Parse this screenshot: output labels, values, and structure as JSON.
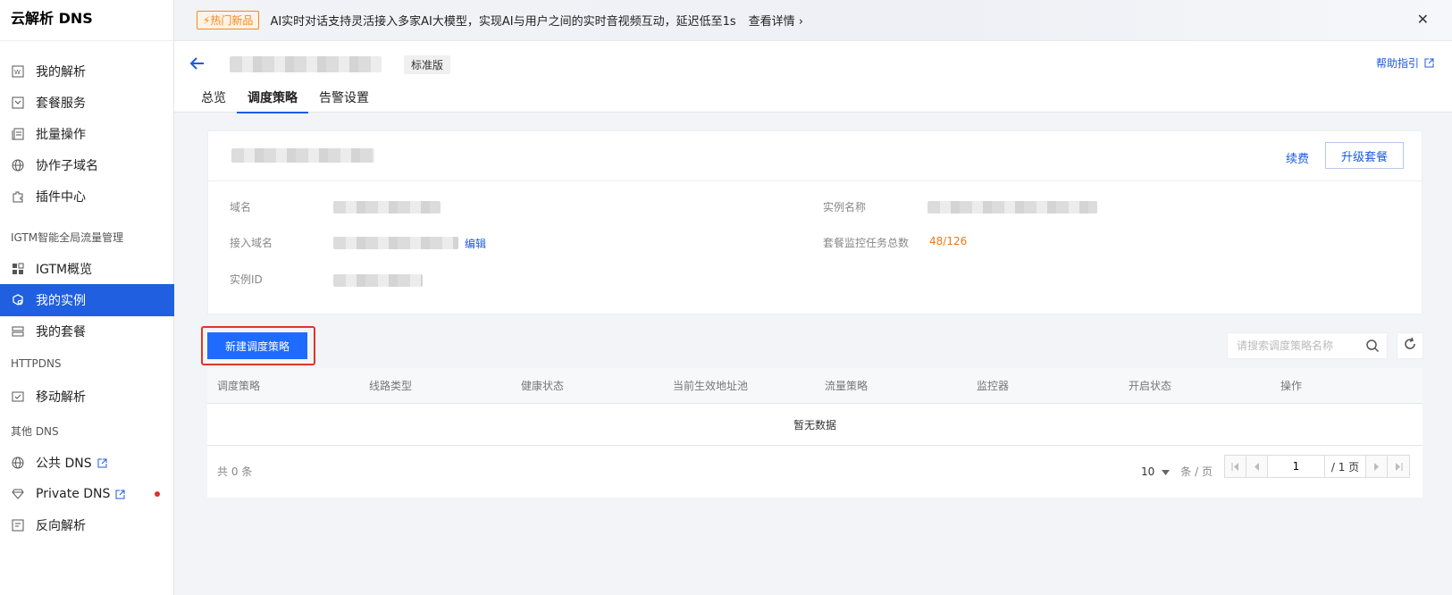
{
  "sidebar": {
    "title": "云解析 DNS",
    "items": [
      {
        "label": "我的解析",
        "icon": "my-dns-icon"
      },
      {
        "label": "套餐服务",
        "icon": "package-icon"
      },
      {
        "label": "批量操作",
        "icon": "batch-icon"
      },
      {
        "label": "协作子域名",
        "icon": "globe-icon"
      },
      {
        "label": "插件中心",
        "icon": "plugin-icon"
      },
      {
        "label": "IGTM概览",
        "icon": "grid-icon"
      },
      {
        "label": "我的实例",
        "icon": "instance-icon"
      },
      {
        "label": "我的套餐",
        "icon": "list-icon"
      },
      {
        "label": "移动解析",
        "icon": "mobile-dns-icon"
      },
      {
        "label": "公共 DNS",
        "icon": "globe-icon"
      },
      {
        "label": "Private DNS",
        "icon": "diamond-icon"
      },
      {
        "label": "反向解析",
        "icon": "reverse-icon"
      }
    ],
    "groups": [
      "IGTM智能全局流量管理",
      "HTTPDNS",
      "其他 DNS"
    ]
  },
  "banner": {
    "tag": "⚡热门新品",
    "text": "AI实时对话支持灵活接入多家AI大模型，实现AI与用户之间的实时音视频互动，延迟低至1s",
    "link": "查看详情 ›",
    "close": "✕"
  },
  "header": {
    "badge": "标准版",
    "help": "帮助指引",
    "tabs": [
      "总览",
      "调度策略",
      "告警设置"
    ],
    "active_tab": "调度策略"
  },
  "card": {
    "renew": "续费",
    "upgrade": "升级套餐",
    "labels": {
      "domain": "域名",
      "access_domain": "接入域名",
      "instance_id": "实例ID",
      "instance_name": "实例名称",
      "monitor_total": "套餐监控任务总数"
    },
    "edit": "编辑",
    "monitor_value": "48/126"
  },
  "toolbar": {
    "new_button": "新建调度策略",
    "search_placeholder": "请搜索调度策略名称"
  },
  "table": {
    "columns": [
      "调度策略",
      "线路类型",
      "健康状态",
      "当前生效地址池",
      "流量策略",
      "监控器",
      "开启状态",
      "操作"
    ],
    "empty_text": "暂无数据",
    "total_text": "共 0 条",
    "page_size": "10",
    "page_size_unit": "条 / 页",
    "current_page": "1",
    "total_pages": "/ 1 页"
  }
}
